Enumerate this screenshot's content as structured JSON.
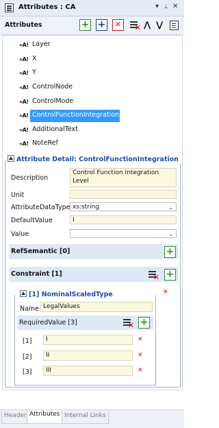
{
  "window": {
    "title_prefix": "Attributes :",
    "title_name": "CA",
    "controls": [
      "▾",
      "📌",
      "✕"
    ]
  },
  "toolbar": {
    "label": "Attributes"
  },
  "attributes": {
    "items": [
      "Layer",
      "X",
      "Y",
      "ControlNode",
      "ControlMode",
      "ControlFunctionIntegration",
      "AdditionalText",
      "NoteRef"
    ],
    "selected": "ControlFunctionIntegration"
  },
  "detail": {
    "title": "Attribute Detail: ControlFunctionIntegration",
    "description_label": "Description",
    "description_value": "Control Function Integration Level",
    "unit_label": "Unit",
    "unit_value": "",
    "datatype_label": "AttributeDataType",
    "datatype_value": "xs:string",
    "default_label": "DefaultValue",
    "default_value": "I",
    "value_label": "Value",
    "value_value": "",
    "refsemantic_label": "RefSemantic [0]",
    "constraint_label": "Constraint [1]"
  },
  "constraint": {
    "title": "[1] NominalScaledType",
    "name_label": "Name",
    "name_value": "LegalValues",
    "required_label": "RequiredValue [3]",
    "values": [
      {
        "index": "[1]",
        "value": "I"
      },
      {
        "index": "[2]",
        "value": "II"
      },
      {
        "index": "[3]",
        "value": "III"
      }
    ]
  },
  "tabs": [
    "Header",
    "Attributes",
    "Internal Links"
  ],
  "active_tab": "Attributes",
  "icons": {
    "plus": "+",
    "delete": "✕",
    "up": "⋀",
    "down": "⋁"
  },
  "colors": {
    "selection": "#3399ff",
    "accent_blue": "#1e4fa8",
    "add_green": "#2d8a2d",
    "delete_red": "#d01010"
  }
}
